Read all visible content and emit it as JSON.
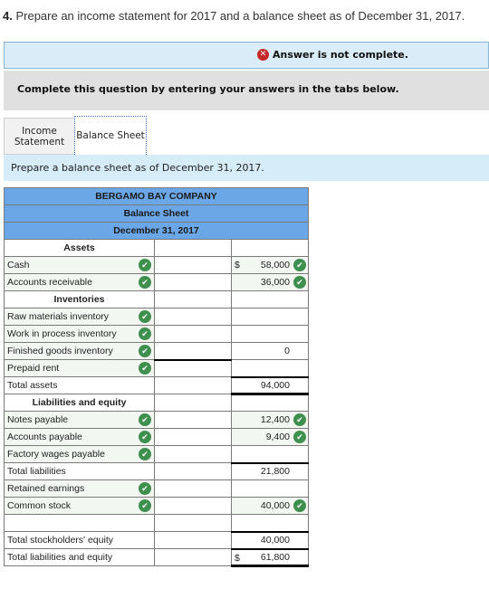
{
  "question": {
    "number": "4.",
    "text": "Prepare an income statement for 2017 and a balance sheet as of December 31, 2017."
  },
  "banner": {
    "status_icon": "error-x-icon",
    "message": "Answer is not complete."
  },
  "instruction": "Complete this question by entering your answers in the tabs below.",
  "tabs": [
    {
      "label_line1": "Income",
      "label_line2": "Statement",
      "active": false
    },
    {
      "label": "Balance Sheet",
      "active": true
    }
  ],
  "prepare_text": "Prepare a balance sheet as of December 31, 2017.",
  "balance_sheet": {
    "company": "BERGAMO BAY COMPANY",
    "title": "Balance Sheet",
    "date": "December 31, 2017",
    "assets_header": "Assets",
    "inventories_header": "Inventories",
    "liab_header": "Liabilities and equity",
    "rows": {
      "cash": {
        "label": "Cash",
        "dollar": "$",
        "value": "58,000"
      },
      "ar": {
        "label": "Accounts receivable",
        "value": "36,000"
      },
      "raw": {
        "label": "Raw materials inventory",
        "value": ""
      },
      "wip": {
        "label": "Work in process inventory",
        "value": ""
      },
      "fg": {
        "label": "Finished goods inventory",
        "value": "0"
      },
      "prepaid": {
        "label": "Prepaid rent",
        "value": ""
      },
      "total_assets": {
        "label": "Total assets",
        "value": "94,000"
      },
      "notes": {
        "label": "Notes payable",
        "value": "12,400"
      },
      "ap": {
        "label": "Accounts payable",
        "value": "9,400"
      },
      "wages": {
        "label": "Factory wages payable",
        "value": ""
      },
      "total_liab": {
        "label": "Total liabilities",
        "value": "21,800"
      },
      "re": {
        "label": "Retained earnings",
        "value": ""
      },
      "cs": {
        "label": "Common stock",
        "value": "40,000"
      },
      "total_se": {
        "label": "Total stockholders' equity",
        "value": "40,000"
      },
      "total_le": {
        "label": "Total liabilities and equity",
        "dollar": "$",
        "value": "61,800"
      }
    }
  },
  "colors": {
    "header_blue": "#6ba7e6",
    "banner_blue": "#d9ecf8",
    "check_green": "#3f8f4e",
    "error_red": "#c62828"
  }
}
